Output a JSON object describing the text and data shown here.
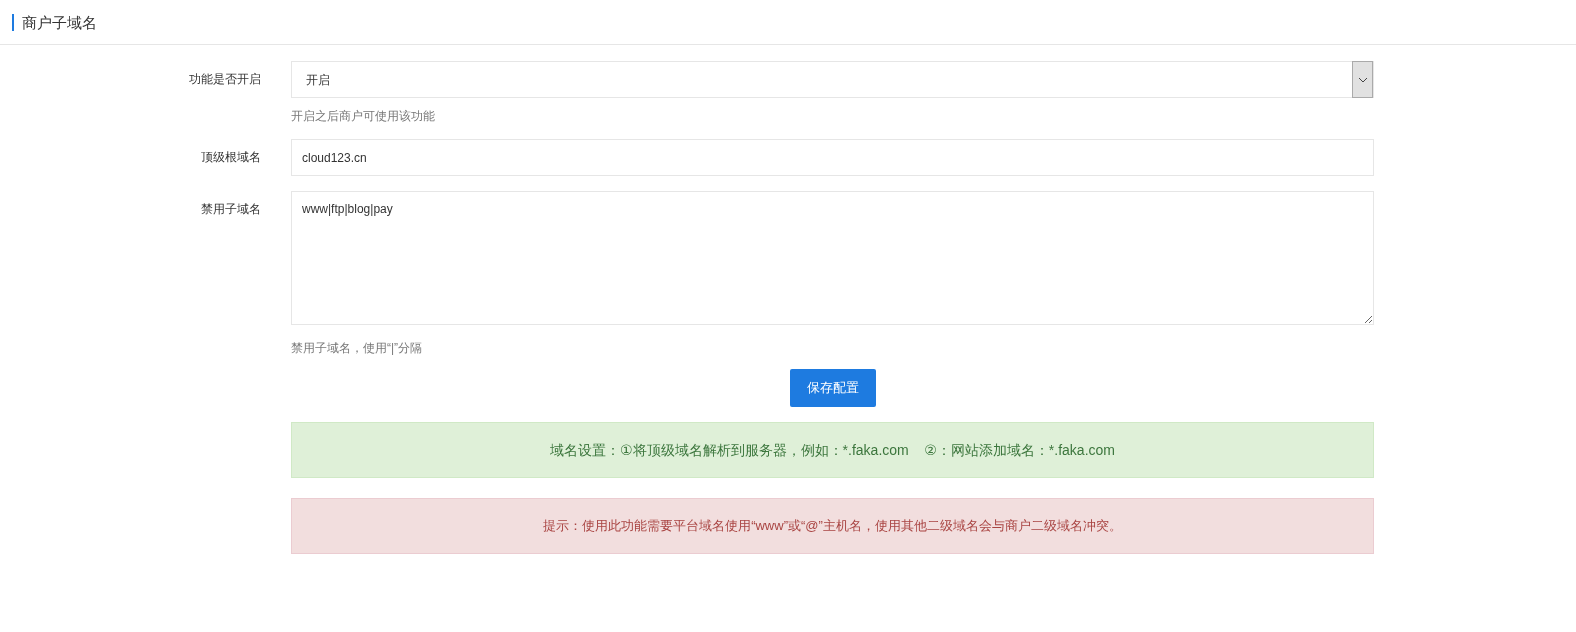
{
  "page_title": "商户子域名",
  "fields": [
    {
      "kind": "select",
      "label": "功能是否开启",
      "value": "开启",
      "help": "开启之后商户可使用该功能"
    },
    {
      "kind": "input",
      "label": "顶级根域名",
      "value": "cloud123.cn"
    },
    {
      "kind": "textarea",
      "label": "禁用子域名",
      "value": "www|ftp|blog|pay",
      "help": "禁用子域名，使用“|”分隔"
    }
  ],
  "save_button": "保存配置",
  "alerts": [
    {
      "kind": "success",
      "text": "域名设置：①将顶级域名解析到服务器，例如：*.faka.com    ②：网站添加域名：*.faka.com"
    },
    {
      "kind": "danger",
      "text": "提示：使用此功能需要平台域名使用“www”或“@”主机名，使用其他二级域名会与商户二级域名冲突。"
    }
  ]
}
